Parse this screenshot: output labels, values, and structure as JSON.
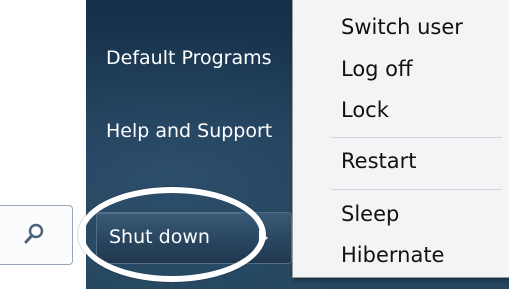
{
  "start_menu": {
    "links": [
      {
        "label": "Default Programs"
      },
      {
        "label": "Help and Support"
      }
    ],
    "shutdown_label": "Shut down"
  },
  "context_menu": {
    "items": [
      {
        "label": "Switch user"
      },
      {
        "label": "Log off"
      },
      {
        "label": "Lock"
      },
      {
        "label": "Restart"
      },
      {
        "label": "Sleep"
      },
      {
        "label": "Hibernate"
      }
    ]
  },
  "icons": [
    "search-icon",
    "arrow-right-icon"
  ],
  "colors": {
    "pane_dark": "#1d3b57",
    "menu_bg": "#f3f4f6",
    "highlight_ring": "#ffffff"
  }
}
